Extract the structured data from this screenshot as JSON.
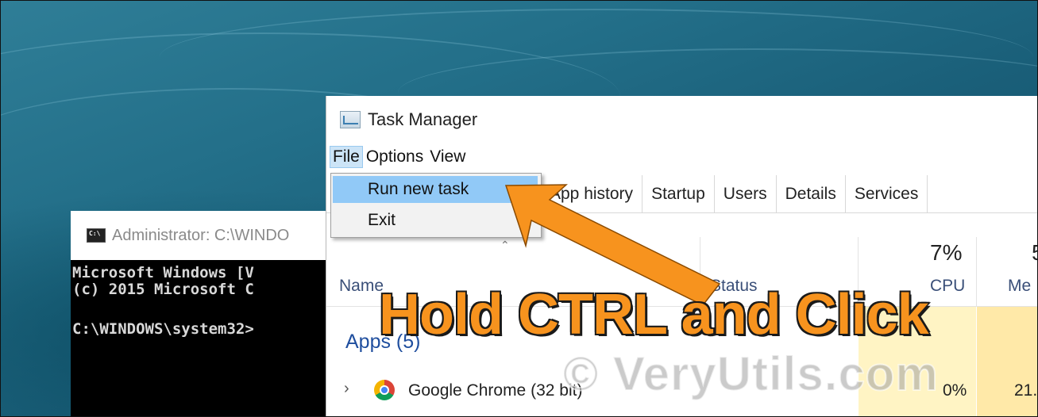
{
  "cmd": {
    "title": "Administrator: C:\\WINDO",
    "lines": [
      "Microsoft Windows [V",
      "(c) 2015 Microsoft C",
      "",
      "C:\\WINDOWS\\system32>"
    ]
  },
  "task_manager": {
    "title": "Task Manager",
    "menu": [
      "File",
      "Options",
      "View"
    ],
    "tabs": [
      "App history",
      "Startup",
      "Users",
      "Details",
      "Services"
    ],
    "columns": {
      "name": "Name",
      "status": "Status",
      "cpu_percent": "7%",
      "cpu": "CPU",
      "memory_percent": "5",
      "memory": "Me"
    },
    "group": "Apps (5)",
    "rows": [
      {
        "name": "Google Chrome (32 bit)",
        "cpu": "0%",
        "memory": "21."
      }
    ]
  },
  "file_menu": {
    "items": [
      "Run new task",
      "Exit"
    ]
  },
  "annotation": "Hold CTRL and Click",
  "watermark": "© VeryUtils.com",
  "colors": {
    "desktop": "#1f6b85",
    "menu_highlight": "#91c9f7",
    "arrow": "#f7931e",
    "cpu_column": "#fff4c4",
    "memory_column": "#ffe9a8"
  }
}
